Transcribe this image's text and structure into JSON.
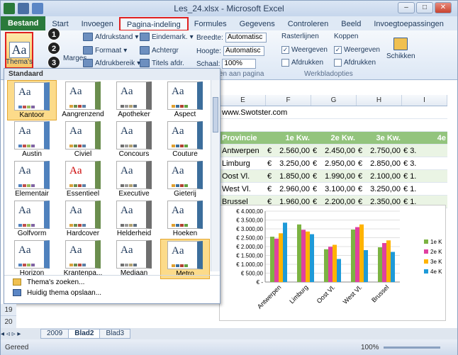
{
  "title": "Les_24.xlsx - Microsoft Excel",
  "tabs": [
    "Bestand",
    "Start",
    "Invoegen",
    "Pagina-indeling",
    "Formules",
    "Gegevens",
    "Controleren",
    "Beeld",
    "Invoegtoepassingen"
  ],
  "active_tab": "Pagina-indeling",
  "ribbon": {
    "themes_label": "Thema's",
    "margins_label": "Marges",
    "col1": [
      "Afdrukstand",
      "Formaat",
      "Afdrukbereik"
    ],
    "col2": [
      "Eindemark.",
      "Achtergr",
      "Titels afdr."
    ],
    "width_label": "Breedte:",
    "height_label": "Hoogte:",
    "scale_label": "Schaal:",
    "width_val": "Automatisc",
    "height_val": "Automatisc",
    "scale_val": "100%",
    "fit_group": "en aan pagina",
    "gridlines": "Rasterlijnen",
    "headings": "Koppen",
    "view": "Weergeven",
    "print": "Afdrukken",
    "sheet_options": "Werkbladopties",
    "arrange": "Schikken"
  },
  "gallery": {
    "header": "Standaard",
    "items": [
      "Kantoor",
      "Aangrenzend",
      "Apotheker",
      "Aspect",
      "Austin",
      "Civiel",
      "Concours",
      "Couture",
      "Elementair",
      "Essentieel",
      "Executive",
      "Gieterij",
      "Golfvorm",
      "Hardcover",
      "Helderheid",
      "Hoeken",
      "Horizon",
      "Krantenpa...",
      "Mediaan",
      "Metro"
    ],
    "thumb_text": "Aa",
    "browse": "Thema's zoeken...",
    "save": "Huidig thema opslaan..."
  },
  "badges": [
    "1",
    "2",
    "3"
  ],
  "columns": [
    "E",
    "F",
    "G",
    "H",
    "I"
  ],
  "url": "www.Swotster.com",
  "table": {
    "headers": [
      "Provincie",
      "1e Kw.",
      "2e Kw.",
      "3e Kw.",
      "4e"
    ],
    "rows": [
      [
        "Antwerpen",
        "€",
        "2.560,00",
        "€",
        "2.450,00",
        "€",
        "2.750,00",
        "€",
        "3."
      ],
      [
        "Limburg",
        "€",
        "3.250,00",
        "€",
        "2.950,00",
        "€",
        "2.850,00",
        "€",
        "3."
      ],
      [
        "Oost Vl.",
        "€",
        "1.850,00",
        "€",
        "1.990,00",
        "€",
        "2.100,00",
        "€",
        "1."
      ],
      [
        "West Vl.",
        "€",
        "2.960,00",
        "€",
        "3.100,00",
        "€",
        "3.250,00",
        "€",
        "1."
      ],
      [
        "Brussel",
        "€",
        "1.960,00",
        "€",
        "2.200,00",
        "€",
        "2.350,00",
        "€",
        "1."
      ]
    ]
  },
  "chart_data": {
    "type": "bar",
    "categories": [
      "Antwerpen",
      "Limburg",
      "Oost Vl.",
      "West Vl.",
      "Brussel"
    ],
    "series": [
      {
        "name": "1e K",
        "values": [
          2560,
          3250,
          1850,
          2960,
          1960
        ],
        "color": "#7cb342"
      },
      {
        "name": "2e K",
        "values": [
          2450,
          2950,
          1990,
          3100,
          2200
        ],
        "color": "#e040a0"
      },
      {
        "name": "3e K",
        "values": [
          2750,
          2850,
          2100,
          3250,
          2350
        ],
        "color": "#ffb300"
      },
      {
        "name": "4e K",
        "values": [
          3350,
          2700,
          1300,
          1800,
          1700
        ],
        "color": "#1e9ad8"
      }
    ],
    "ylim": [
      0,
      4000
    ],
    "yticks": [
      "€ 4.000,00",
      "€ 3.500,00",
      "€ 3.000,00",
      "€ 2.500,00",
      "€ 2.000,00",
      "€ 1.500,00",
      "€ 1.000,00",
      "€ 500,00",
      "€ -"
    ]
  },
  "sheet_tabs": [
    "2009",
    "Blad2",
    "Blad3"
  ],
  "active_sheet": "Blad2",
  "row_numbers": [
    "19",
    "20"
  ],
  "status": "Gereed",
  "zoom": "100%"
}
